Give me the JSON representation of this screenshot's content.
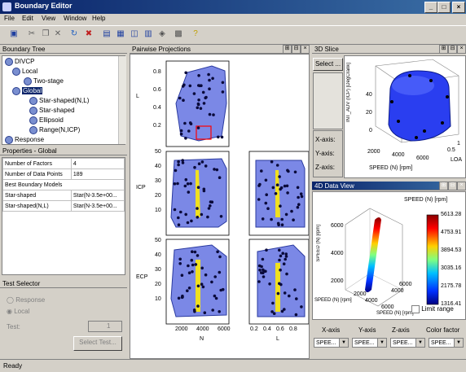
{
  "window": {
    "title": "Boundary Editor"
  },
  "menu": [
    "File",
    "Edit",
    "View",
    "Window",
    "Help"
  ],
  "boundary_tree": {
    "header": "Boundary Tree",
    "items": [
      "DIVCP",
      "Local",
      "Two-stage",
      "Global",
      "Star-shaped(N,L)",
      "Star-shaped",
      "Ellipsoid",
      "Range(N,ICP)",
      "Response"
    ]
  },
  "properties": {
    "header": "Properties - Global",
    "rows": [
      {
        "label": "Number of Factors",
        "value": "4"
      },
      {
        "label": "Number of Data Points",
        "value": "189"
      }
    ],
    "best_models_title": "Best Boundary Models",
    "models": [
      {
        "label": "Star-shaped",
        "value": "Star(N-3.5e+00..."
      },
      {
        "label": "Star-shaped(N,L)",
        "value": "Star(N-3.5e+00..."
      }
    ]
  },
  "test_selector": {
    "header": "Test Selector",
    "options": [
      "Response",
      "Local"
    ],
    "test_label": "Test:",
    "test_value": "1",
    "select_button": "Select Test..."
  },
  "pairwise": {
    "header": "Pairwise Projections",
    "ylabels": [
      "L",
      "ICP",
      "ECP"
    ],
    "xlabels": [
      "N",
      "L"
    ],
    "ticks_L": [
      "0.8",
      "0.6",
      "0.4",
      "0.2"
    ],
    "ticks_ICP": [
      "50",
      "40",
      "30",
      "20",
      "10"
    ],
    "ticks_ECP": [
      "50",
      "40",
      "30",
      "20",
      "10"
    ],
    "xticks_N": [
      "2000",
      "4000",
      "6000"
    ],
    "xticks_L": [
      "0.2",
      "0.4",
      "0.6",
      "0.8"
    ]
  },
  "slice3d": {
    "header": "3D Slice",
    "select_button": "Select ...",
    "axis_labels": [
      "X-axis:",
      "Y-axis:",
      "Z-axis:"
    ],
    "zlabel": "INT_ADV (ICP) [DegCrank]",
    "xlabel": "SPEED (N) [rpm]",
    "ylabel": "LOA",
    "zticks": [
      "40",
      "20",
      "0"
    ],
    "xticks": [
      "2000",
      "4000",
      "6000"
    ],
    "yticks": [
      "0.5",
      "1"
    ]
  },
  "data4d": {
    "header": "4D Data View",
    "colorbar_title": "SPEED (N) [rpm]",
    "colorbar_ticks": [
      "5613.28",
      "4753.91",
      "3894.53",
      "3035.16",
      "2175.78",
      "1316.41"
    ],
    "zlabel": "SPEED (N) [rpm]",
    "xlabel": "SPEED (N) [rpm]",
    "ylabel": "SPEED (N) [rpm]",
    "zticks": [
      "6000",
      "4000",
      "2000"
    ],
    "xticks": [
      "2000",
      "4000",
      "6000"
    ],
    "yticks": [
      "4000",
      "6000"
    ],
    "limit_range": "Limit range",
    "combo_labels": [
      "X-axis",
      "Y-axis",
      "Z-axis",
      "Color factor"
    ],
    "combo_values": [
      "SPEE...",
      "SPEE...",
      "SPEE...",
      "SPEE..."
    ]
  },
  "status": "Ready",
  "colors": {
    "title_start": "#0a246a",
    "title_end": "#3a6ea5",
    "boundary_fill": "#7b88e6",
    "points": "#0a0a3a",
    "highlight": "#f0e020",
    "surface": "#2a3ef0"
  }
}
